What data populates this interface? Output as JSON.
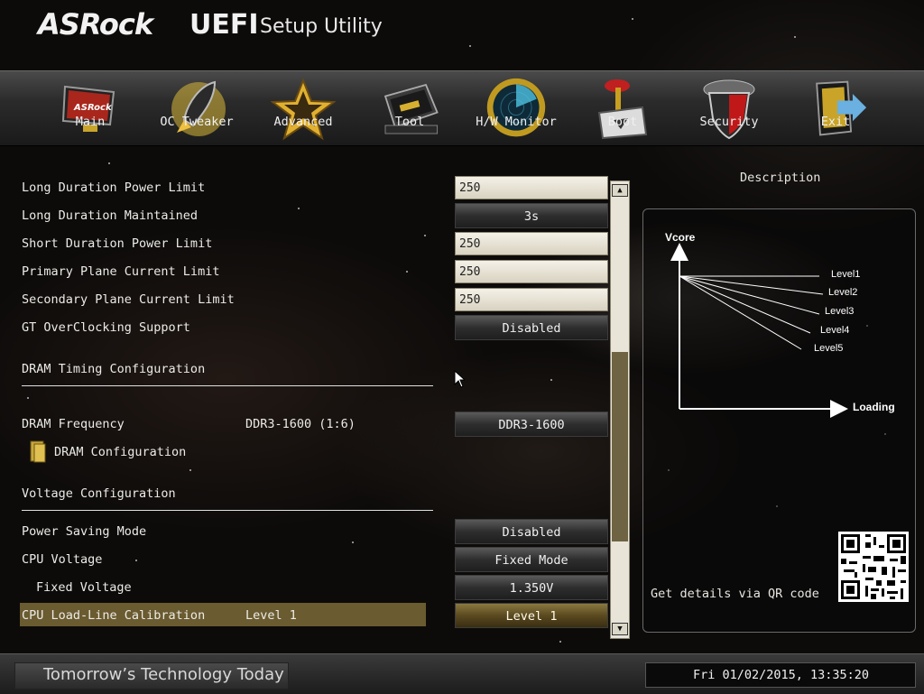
{
  "header": {
    "brand": "ASRock",
    "title_bold": "UEFI",
    "title_rest": "Setup Utility"
  },
  "nav": [
    {
      "label": "Main",
      "icon": "monitor-icon"
    },
    {
      "label": "OC Tweaker",
      "icon": "rocket-icon"
    },
    {
      "label": "Advanced",
      "icon": "star-icon"
    },
    {
      "label": "Tool",
      "icon": "toolbox-icon"
    },
    {
      "label": "H/W Monitor",
      "icon": "radar-icon"
    },
    {
      "label": "Boot",
      "icon": "joystick-icon"
    },
    {
      "label": "Security",
      "icon": "shield-icon"
    },
    {
      "label": "Exit",
      "icon": "exit-door-icon"
    }
  ],
  "settings": {
    "long_duration_power_limit": {
      "label": "Long Duration Power Limit",
      "value": "250"
    },
    "long_duration_maintained": {
      "label": "Long Duration Maintained",
      "value": "3s"
    },
    "short_duration_power_limit": {
      "label": "Short Duration Power Limit",
      "value": "250"
    },
    "primary_plane_current_limit": {
      "label": "Primary Plane Current Limit",
      "value": "250"
    },
    "secondary_plane_current_limit": {
      "label": "Secondary Plane Current Limit",
      "value": "250"
    },
    "gt_overclocking_support": {
      "label": "GT OverClocking Support",
      "value": "Disabled"
    },
    "dram_timing_section": "DRAM Timing Configuration",
    "dram_frequency": {
      "label": "DRAM Frequency",
      "current": "DDR3-1600 (1:6)",
      "value": "DDR3-1600"
    },
    "dram_configuration": "DRAM Configuration",
    "voltage_section": "Voltage Configuration",
    "power_saving_mode": {
      "label": "Power Saving Mode",
      "value": "Disabled"
    },
    "cpu_voltage": {
      "label": "CPU Voltage",
      "value": "Fixed Mode"
    },
    "fixed_voltage": {
      "label": "Fixed Voltage",
      "value": "1.350V"
    },
    "cpu_llc": {
      "label": "CPU Load-Line Calibration",
      "current": "Level 1",
      "value": "Level 1"
    }
  },
  "description": {
    "title": "Description",
    "diagram": {
      "y_label": "Vcore",
      "x_label": "Loading",
      "levels": [
        "Level1",
        "Level2",
        "Level3",
        "Level4",
        "Level5"
      ]
    },
    "qr_text": "Get details via QR code"
  },
  "footer": {
    "tagline": "Tomorrow’s Technology Today",
    "datetime": "Fri 01/02/2015, 13:35:20"
  }
}
